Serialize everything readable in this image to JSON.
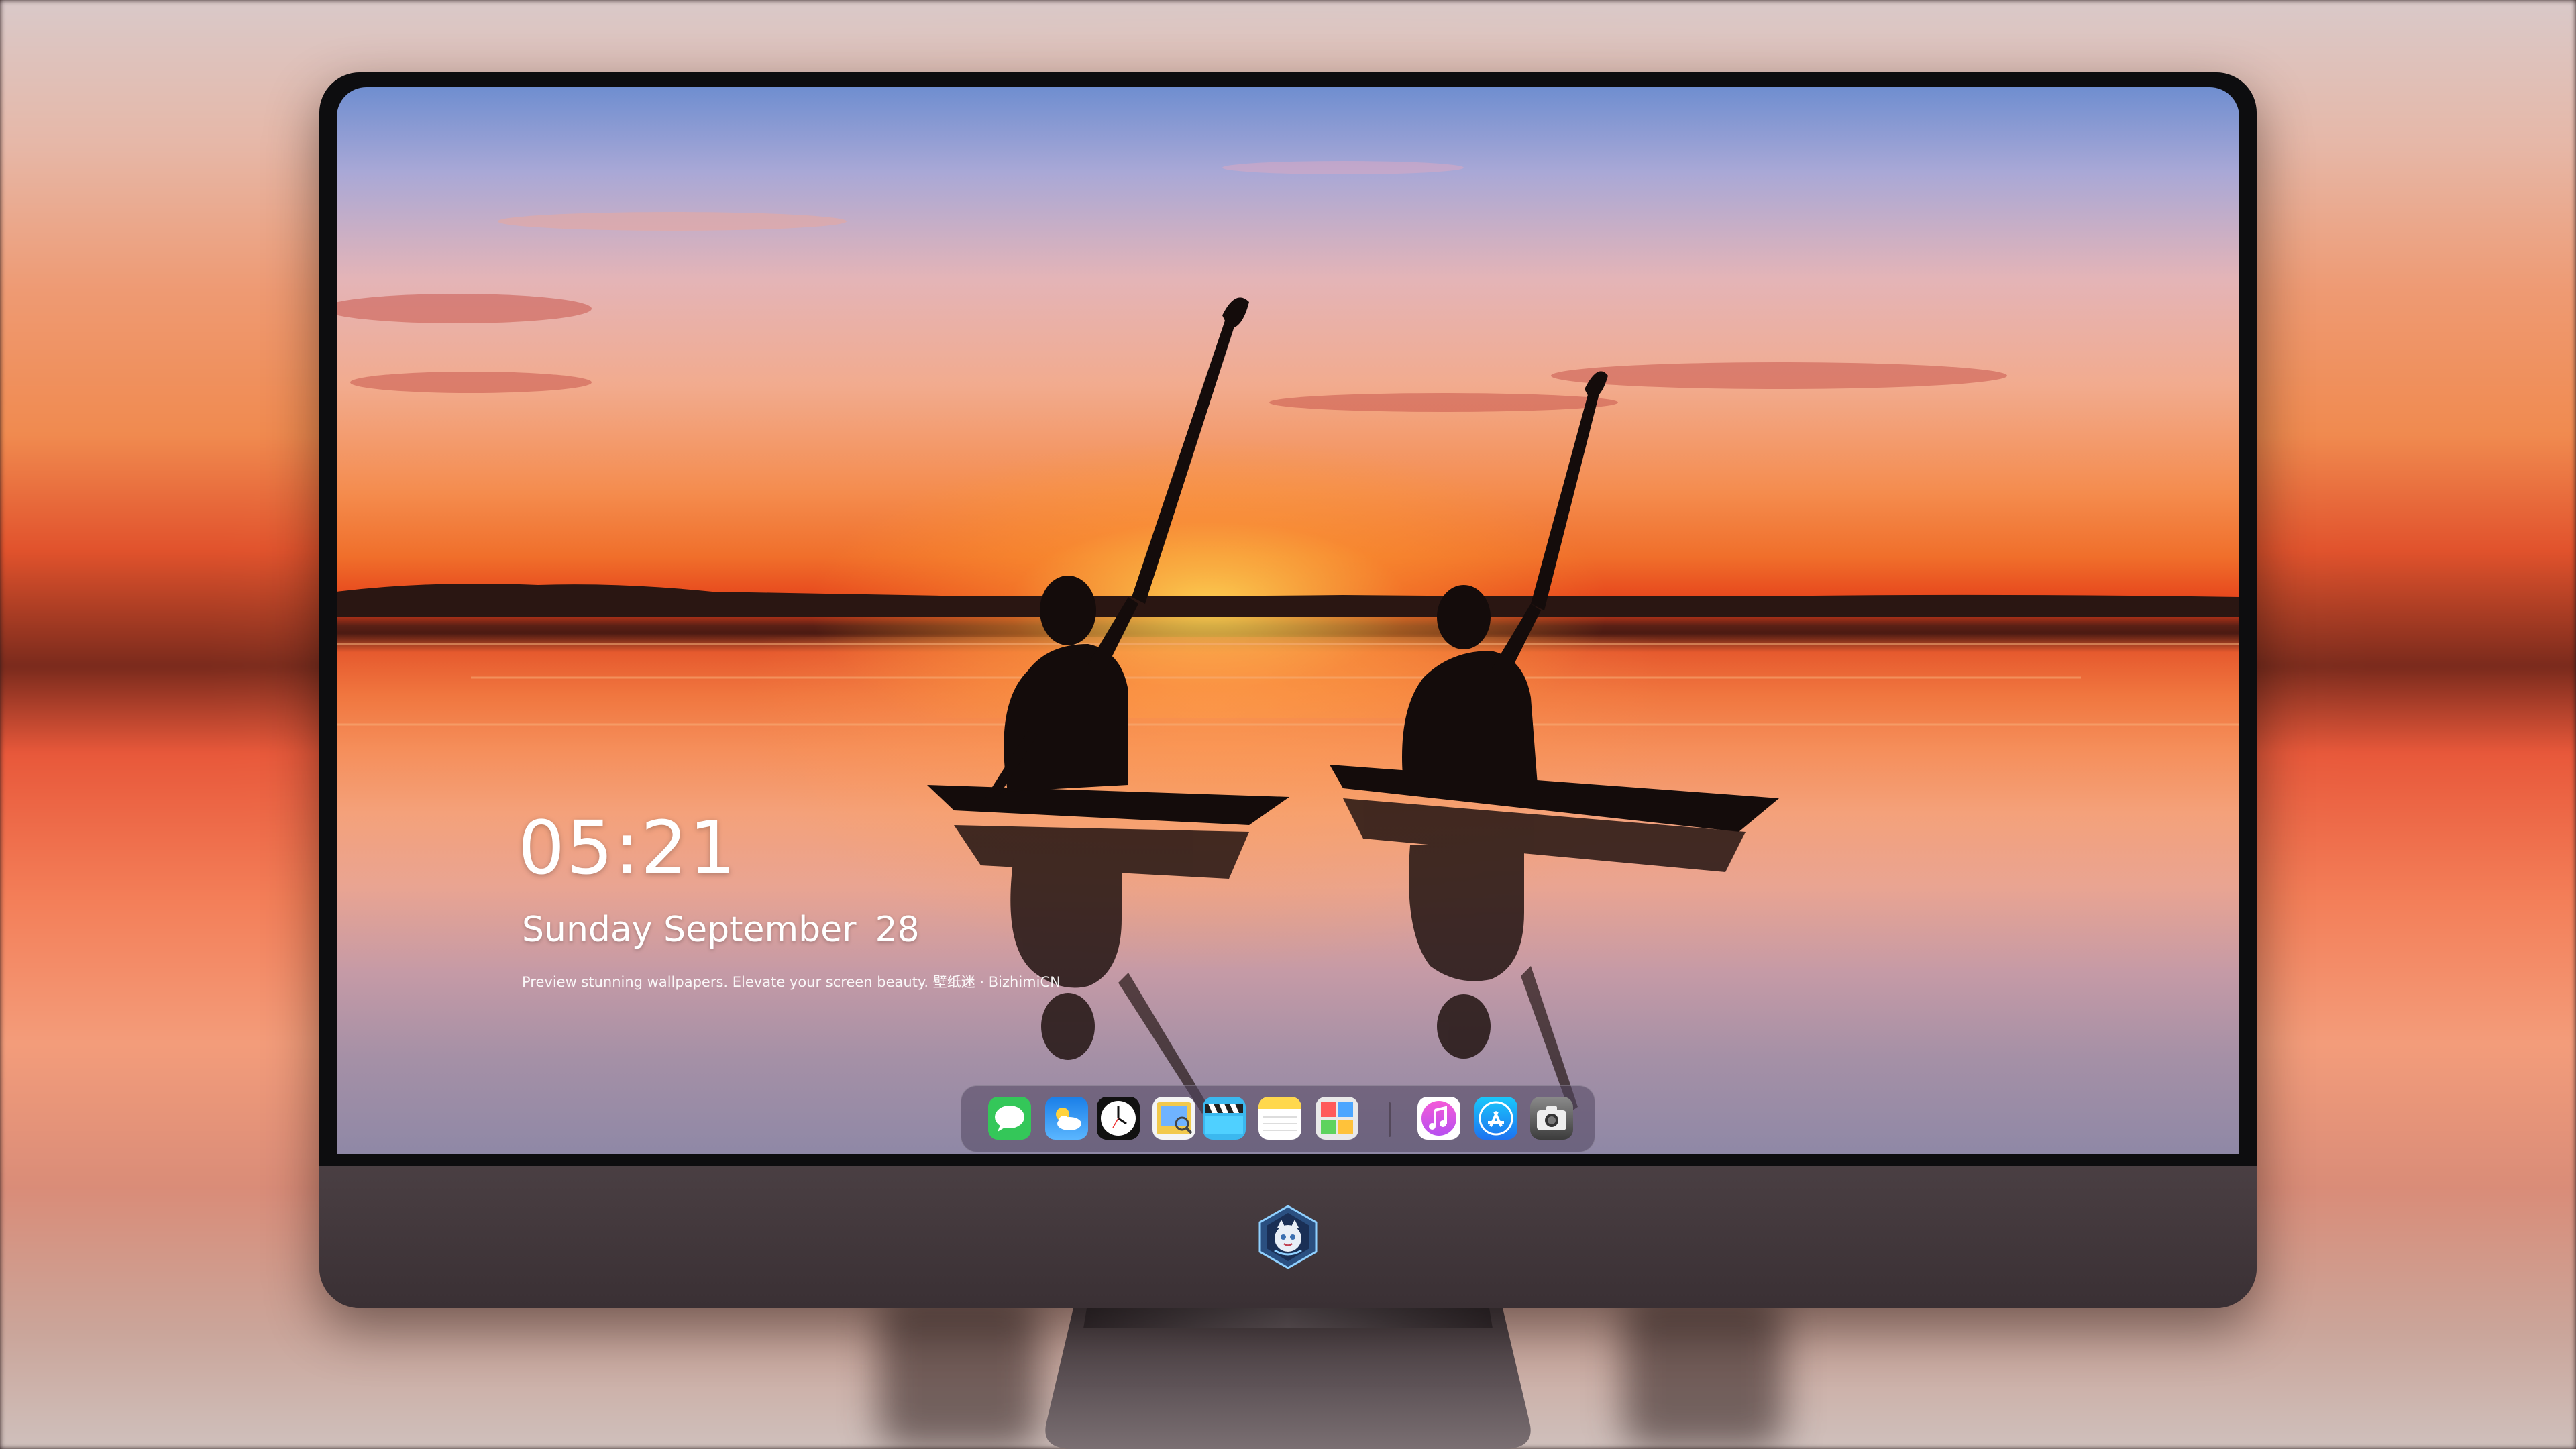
{
  "lockscreen": {
    "time": "05:21",
    "weekday": "Sunday",
    "month": "September",
    "day": "28",
    "tagline": "Preview stunning wallpapers. Elevate your screen beauty. 壁纸迷 · BizhimiCN"
  },
  "dock": {
    "apps": [
      {
        "icon": "messages-icon",
        "color": "#2fd158"
      },
      {
        "icon": "weather-icon",
        "color": "#2a8cf0"
      },
      {
        "icon": "clock-icon",
        "color": "#ffffff"
      },
      {
        "icon": "preview-icon",
        "color": "#f2c94c"
      },
      {
        "icon": "clips-icon",
        "color": "#39b7f0"
      },
      {
        "icon": "notes-icon",
        "color": "#ffd84d"
      },
      {
        "icon": "photo-booth-icon",
        "color": "#e8e8e8"
      },
      {
        "icon": "itunes-icon",
        "color": "#e34fd3"
      },
      {
        "icon": "app-store-icon",
        "color": "#1d9bf6"
      },
      {
        "icon": "camera-icon",
        "color": "#555555"
      }
    ]
  },
  "monitor": {
    "bezel_color": "#0d0d0f",
    "chin_color": "#3f3539",
    "logo_icon": "mascot-logo-icon"
  }
}
